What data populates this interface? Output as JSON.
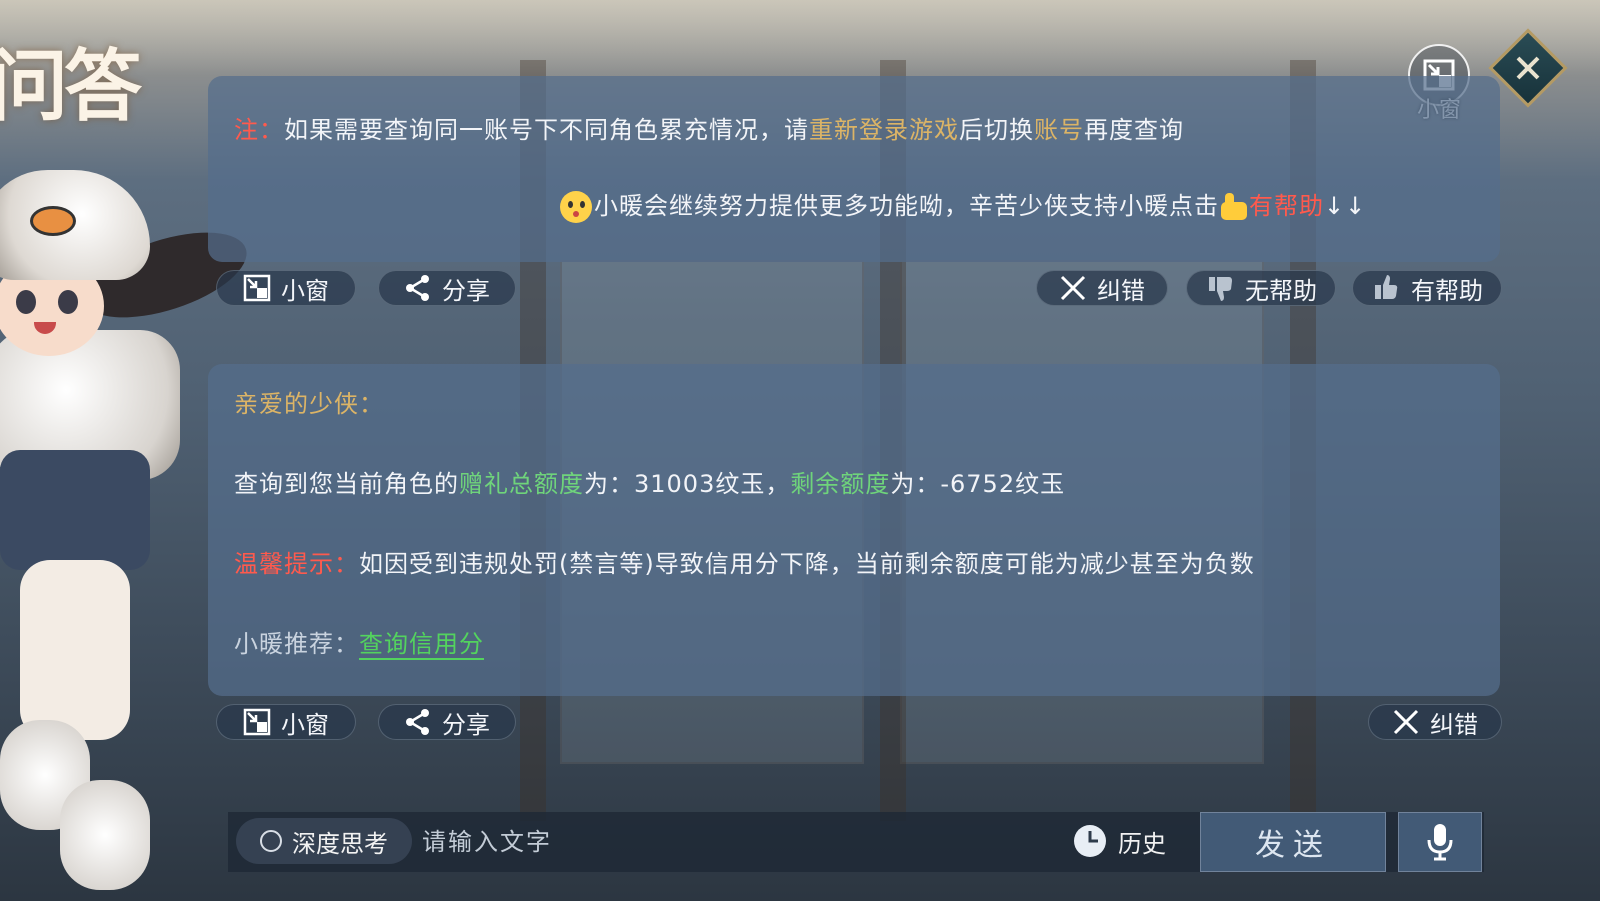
{
  "header": {
    "title_logo": "问答",
    "mini_window_label": "小窗"
  },
  "message1": {
    "note_prefix": "注：",
    "note_part1": "如果需要查询同一账号下不同角色累充情况，请",
    "note_highlight1": "重新登录游戏",
    "note_part2": "后切换",
    "note_highlight2": "账号",
    "note_part3": "再度查询",
    "footer_text": "小暖会继续努力提供更多功能呦，辛苦少侠支持小暖点击",
    "footer_highlight": "有帮助",
    "footer_arrows": "↓↓",
    "actions": {
      "mini": "小窗",
      "share": "分享",
      "correct": "纠错",
      "unhelpful": "无帮助",
      "helpful": "有帮助"
    }
  },
  "message2": {
    "greeting": "亲爱的少侠：",
    "query_prefix": "查询到您当前角色的",
    "gift_label": "赠礼总额度",
    "gift_value": "为：31003纹玉，",
    "remaining_label": "剩余额度",
    "remaining_value": "为：-6752纹玉",
    "tip_label": "温馨提示：",
    "tip_text": "如因受到违规处罚(禁言等)导致信用分下降，当前剩余额度可能为减少甚至为负数",
    "recommend_label": "小暖推荐：",
    "recommend_link": "查询信用分",
    "actions": {
      "mini": "小窗",
      "share": "分享",
      "correct": "纠错"
    }
  },
  "input_bar": {
    "deep_think": "深度思考",
    "placeholder": "请输入文字",
    "history": "历史",
    "send": "发送"
  },
  "colors": {
    "panel": "#556e8c",
    "red": "#ff5a4d",
    "gold": "#dcb466",
    "green": "#5fcf7c",
    "link": "#53d35e"
  },
  "icons": [
    "minimize-window-icon",
    "share-icon",
    "close-x-icon",
    "thumbs-down-icon",
    "thumbs-up-icon",
    "clock-icon",
    "microphone-icon",
    "emoji-icon"
  ]
}
